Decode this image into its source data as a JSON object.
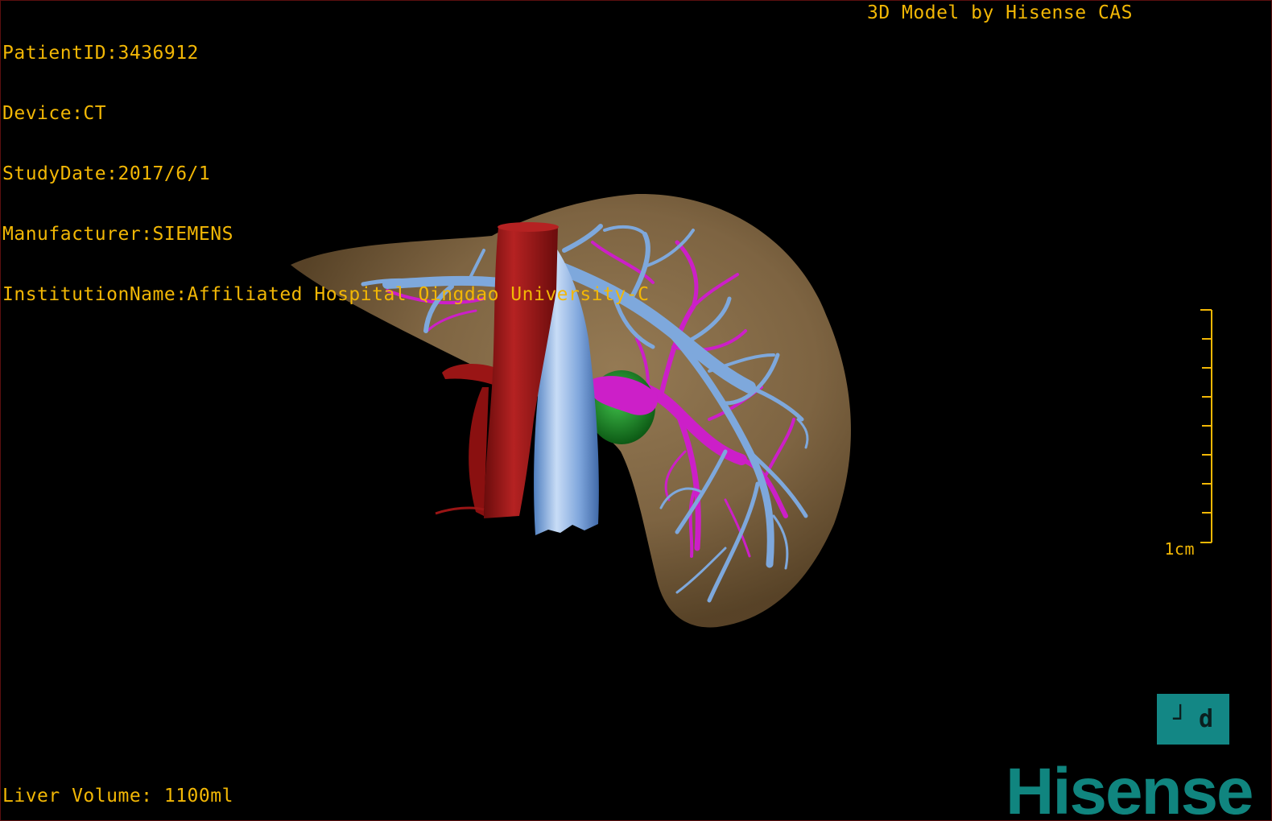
{
  "info": {
    "patient_id": "PatientID:3436912",
    "device": "Device:CT",
    "study_date": "StudyDate:2017/6/1",
    "manufacturer": "Manufacturer:SIEMENS",
    "institution": "InstitutionName:Affiliated Hospital Qingdao University-C"
  },
  "credit": "3D Model by Hisense CAS",
  "liver_volume": "Liver Volume: 1100ml",
  "scale": {
    "label": "1cm"
  },
  "view_toggle": {
    "glyph_left": "┘",
    "glyph_right": "d"
  },
  "brand": "Hisense",
  "colors": {
    "overlay_text": "#f2b705",
    "liver": "#8a6f4b",
    "ivc": "#a01818",
    "portal_vein": "#7ea8dc",
    "hepatic_vein": "#cc1fc8",
    "gallbladder": "#1e8f28",
    "brand": "#10857f"
  }
}
